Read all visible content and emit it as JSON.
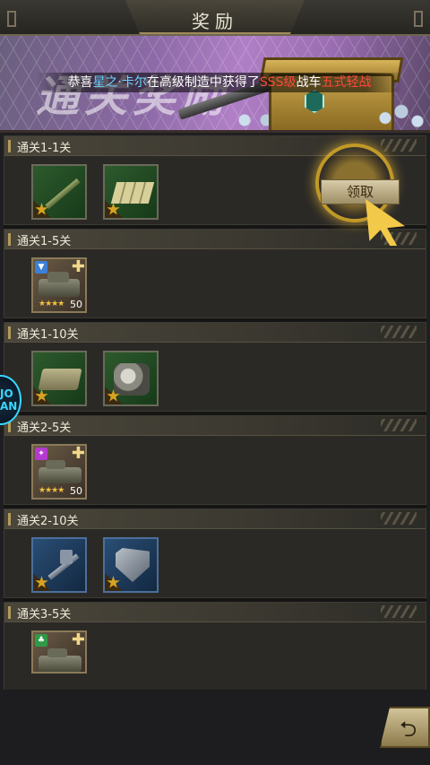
{
  "window": {
    "title": "奖励"
  },
  "banner": {
    "bg_title": "通关奖励",
    "ticker": {
      "prefix": "恭喜",
      "player": "星之·卡尔",
      "middle": "在高级制造中获得了",
      "grade": "SSS级",
      "unit": "战车",
      "tank": "五式轻战"
    }
  },
  "sections": [
    {
      "label": "通关1-1关",
      "items": [
        {
          "icon": "tank-cannon-icon",
          "star": "1"
        },
        {
          "icon": "armor-plate-icon",
          "star": "1"
        }
      ],
      "claim_label": "领取"
    },
    {
      "label": "通关1-5关",
      "items": [
        {
          "icon": "tank-fragment-icon",
          "stars": "★★★★",
          "count": "50"
        }
      ]
    },
    {
      "label": "通关1-10关",
      "items": [
        {
          "icon": "tank-track-icon",
          "star": "1"
        },
        {
          "icon": "engine-icon",
          "star": "1"
        }
      ]
    },
    {
      "label": "通关2-5关",
      "items": [
        {
          "icon": "tank-fragment-icon",
          "stars": "★★★★",
          "count": "50"
        }
      ]
    },
    {
      "label": "通关2-10关",
      "items": [
        {
          "icon": "turret-icon",
          "star": "1"
        },
        {
          "icon": "shield-armor-icon",
          "star": "1"
        }
      ]
    },
    {
      "label": "通关3-5关",
      "items": [
        {
          "icon": "tank-fragment-icon"
        }
      ]
    }
  ],
  "side_icon": {
    "text": "JO\nAN"
  },
  "colors": {
    "accent_gold": "#d9a322",
    "highlight_blue": "#6fd0ff",
    "highlight_red": "#ff4a3a"
  }
}
